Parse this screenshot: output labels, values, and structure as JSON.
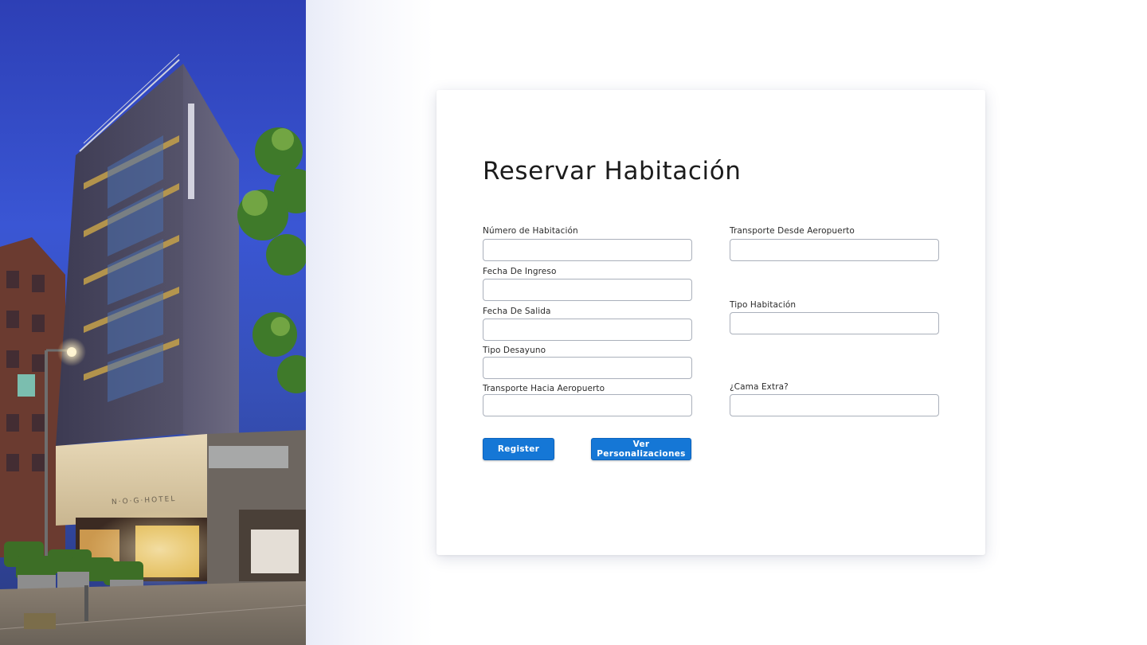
{
  "photo": {
    "alt_icon": "hotel-photo",
    "sign_text": "N·O·G·HOTEL"
  },
  "form": {
    "title": "Reservar Habitación",
    "fields": {
      "numero_habitacion": {
        "label": "Número de Habitación",
        "value": ""
      },
      "fecha_ingreso": {
        "label": "Fecha De Ingreso",
        "value": ""
      },
      "fecha_salida": {
        "label": "Fecha De Salida",
        "value": ""
      },
      "tipo_desayuno": {
        "label": "Tipo Desayuno",
        "value": ""
      },
      "transporte_hacia": {
        "label": "Transporte Hacia Aeropuerto",
        "value": ""
      },
      "transporte_desde": {
        "label": "Transporte Desde Aeropuerto",
        "value": ""
      },
      "tipo_habitacion": {
        "label": "Tipo Habitación",
        "value": ""
      },
      "cama_extra": {
        "label": "¿Cama Extra?",
        "value": ""
      }
    },
    "buttons": {
      "register": "Register",
      "ver_personalizaciones": "Ver Personalizaciones"
    }
  },
  "colors": {
    "primary_button": "#1577d6",
    "input_border": "#aab0bb",
    "title_text": "#1c1c1c"
  }
}
